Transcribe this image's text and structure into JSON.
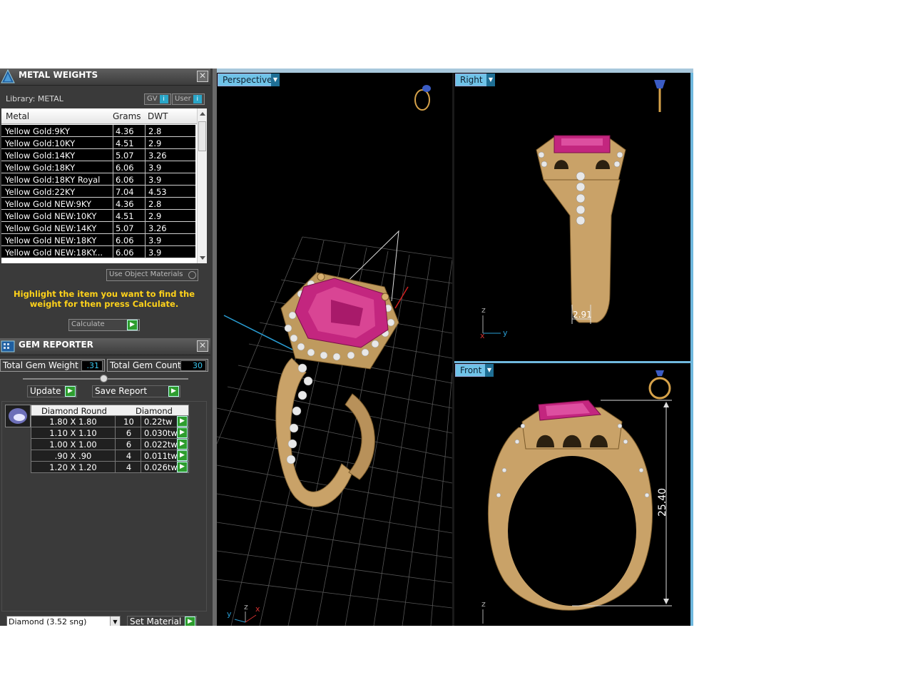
{
  "metal_weights": {
    "title": "METAL WEIGHTS",
    "library_label": "Library: METAL",
    "gv_label": "GV",
    "user_label": "User",
    "info_glyph": "i",
    "columns": [
      "Metal",
      "Grams",
      "DWT"
    ],
    "rows": [
      {
        "metal": "Yellow Gold:9KY",
        "grams": "4.36",
        "dwt": "2.8"
      },
      {
        "metal": "Yellow Gold:10KY",
        "grams": "4.51",
        "dwt": "2.9"
      },
      {
        "metal": "Yellow Gold:14KY",
        "grams": "5.07",
        "dwt": "3.26"
      },
      {
        "metal": "Yellow Gold:18KY",
        "grams": "6.06",
        "dwt": "3.9"
      },
      {
        "metal": "Yellow Gold:18KY Royal",
        "grams": "6.06",
        "dwt": "3.9"
      },
      {
        "metal": "Yellow Gold:22KY",
        "grams": "7.04",
        "dwt": "4.53"
      },
      {
        "metal": "Yellow Gold NEW:9KY",
        "grams": "4.36",
        "dwt": "2.8"
      },
      {
        "metal": "Yellow Gold NEW:10KY",
        "grams": "4.51",
        "dwt": "2.9"
      },
      {
        "metal": "Yellow Gold NEW:14KY",
        "grams": "5.07",
        "dwt": "3.26"
      },
      {
        "metal": "Yellow Gold NEW:18KY",
        "grams": "6.06",
        "dwt": "3.9"
      },
      {
        "metal": "Yellow Gold NEW:18KY...",
        "grams": "6.06",
        "dwt": "3.9"
      }
    ],
    "use_object_materials": "Use Object Materials",
    "hint": "Highlight the item you want to find the weight for then press Calculate.",
    "calculate_label": "Calculate",
    "close_glyph": "✕"
  },
  "gem_reporter": {
    "title": "GEM REPORTER",
    "total_weight_label": "Total Gem Weight",
    "total_weight_value": ".31",
    "total_count_label": "Total Gem Count",
    "total_count_value": "30",
    "update_label": "Update",
    "save_report_label": "Save Report",
    "columns": [
      "Diamond Round",
      "Diamond"
    ],
    "rows": [
      {
        "size": "1.80 X 1.80",
        "count": "10",
        "weight": "0.22tw"
      },
      {
        "size": "1.10 X 1.10",
        "count": "6",
        "weight": "0.030tw"
      },
      {
        "size": "1.00 X 1.00",
        "count": "6",
        "weight": "0.022tw"
      },
      {
        "size": ".90 X .90",
        "count": "4",
        "weight": "0.011tw"
      },
      {
        "size": "1.20 X 1.20",
        "count": "4",
        "weight": "0.026tw"
      }
    ],
    "material_select": "Diamond   (3.52 sng)",
    "set_material_label": "Set Material"
  },
  "viewports": {
    "perspective": {
      "label": "Perspective"
    },
    "right": {
      "label": "Right",
      "dimension": "2.91"
    },
    "front": {
      "label": "Front",
      "dimension": "25.40"
    }
  },
  "axis_labels": {
    "z": "z",
    "x": "x",
    "y": "y"
  },
  "colors": {
    "accent_tab": "#6fc3e8",
    "hint_yellow": "#ffd21a",
    "gold": "#c9a268",
    "ruby": "#c3267f",
    "go_green": "#2e9d2e"
  }
}
